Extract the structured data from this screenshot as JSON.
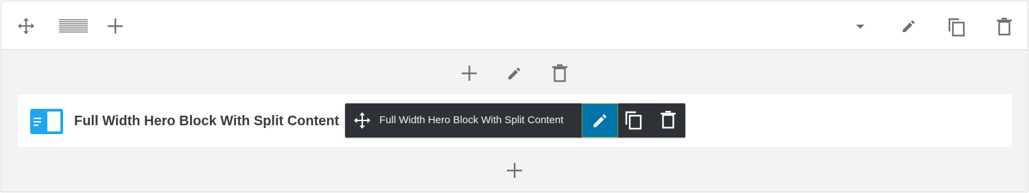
{
  "block": {
    "title": "Full Width Hero Block With Split Content"
  },
  "toolbar": {
    "label": "Full Width Hero Block With Split Content"
  },
  "colors": {
    "accent": "#0073aa",
    "icon_gray": "#707070",
    "block_icon": "#1ea7f0",
    "toolbar_bg": "#2e3237"
  },
  "icons": {
    "row_toolbar_left": [
      "move-icon",
      "layout-icon",
      "add-icon"
    ],
    "row_toolbar_right": [
      "chevron-down-icon",
      "edit-icon",
      "duplicate-icon",
      "delete-icon"
    ],
    "column_toolbar": [
      "add-icon",
      "edit-icon",
      "delete-icon"
    ],
    "block_toolbar": [
      "move-icon",
      "edit-icon",
      "duplicate-icon",
      "delete-icon"
    ],
    "bottom": [
      "add-icon"
    ]
  }
}
